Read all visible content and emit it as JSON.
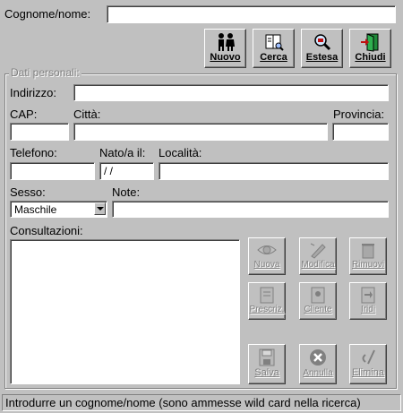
{
  "top": {
    "name_label": "Cognome/nome:",
    "name_value": ""
  },
  "toolbar": {
    "nuovo": "Nuovo",
    "cerca": "Cerca",
    "estesa": "Estesa",
    "chiudi": "Chiudi"
  },
  "group_title": "Dati personali:",
  "form": {
    "indirizzo_label": "Indirizzo:",
    "indirizzo_value": "",
    "cap_label": "CAP:",
    "cap_value": "",
    "citta_label": "Città:",
    "citta_value": "",
    "provincia_label": "Provincia:",
    "provincia_value": "",
    "telefono_label": "Telefono:",
    "telefono_value": "",
    "nato_label": "Nato/a il:",
    "nato_value": " / /",
    "localita_label": "Località:",
    "localita_value": "",
    "sesso_label": "Sesso:",
    "sesso_value": "Maschile",
    "note_label": "Note:",
    "note_value": "",
    "consultazioni_label": "Consultazioni:"
  },
  "side_buttons": {
    "nuova": "Nuova",
    "modifica": "Modifica",
    "rimuovi": "Rimuovi",
    "prescriz": "Prescriz.",
    "cliente": "Cliente",
    "iridi": "Iridi",
    "salva": "Salva",
    "annulla": "Annulla",
    "elimina": "Elimina"
  },
  "status": "Introdurre un cognome/nome (sono ammesse wild card nella ricerca)",
  "colors": {
    "window_bg": "#c0c0c0",
    "field_bg": "#ffffff",
    "disabled_text": "#808080",
    "door_green": "#1f8a3a",
    "door_red": "#c01010"
  },
  "icons": {
    "nuovo": "people-icon",
    "cerca": "book-search-icon",
    "estesa": "magnifier-icon",
    "chiudi": "exit-door-icon",
    "nuova": "eye-icon",
    "modifica": "edit-icon",
    "rimuovi": "trash-icon",
    "prescriz": "prescription-icon",
    "cliente": "client-icon",
    "iridi": "iris-icon",
    "salva": "save-icon",
    "annulla": "cancel-icon",
    "elimina": "delete-icon"
  }
}
